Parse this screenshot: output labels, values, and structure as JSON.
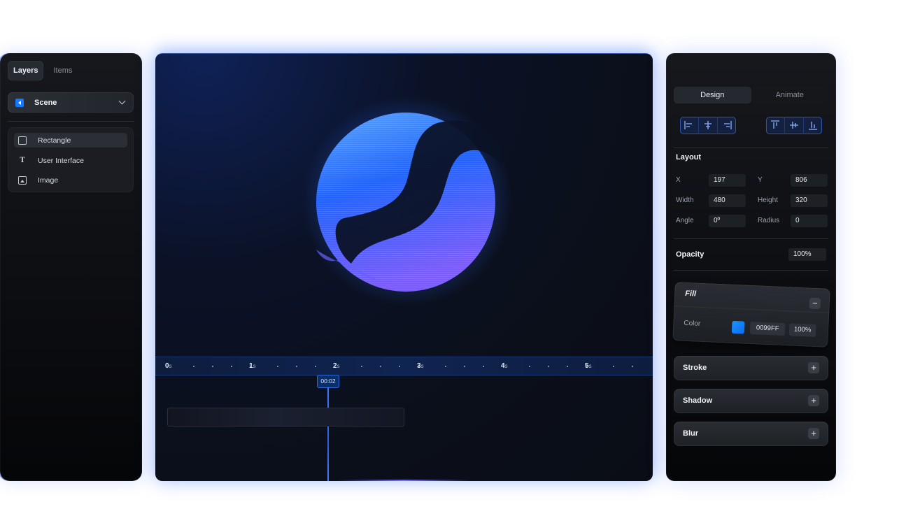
{
  "left_panel": {
    "tabs": [
      {
        "label": "Layers",
        "active": true
      },
      {
        "label": "Items",
        "active": false
      }
    ],
    "scene_select": {
      "label": "Scene",
      "icon": "play-left-icon"
    },
    "layers": [
      {
        "label": "Rectangle",
        "icon": "rectangle-icon",
        "selected": true
      },
      {
        "label": "User Interface",
        "icon": "text-icon",
        "selected": false
      },
      {
        "label": "Image",
        "icon": "image-icon",
        "selected": false
      }
    ]
  },
  "canvas": {
    "art": "blue-gradient-sphere",
    "timeline": {
      "ticks": [
        {
          "num": "0",
          "unit": "s"
        },
        {
          "num": "1",
          "unit": "s"
        },
        {
          "num": "2",
          "unit": "s"
        },
        {
          "num": "3",
          "unit": "s"
        },
        {
          "num": "4",
          "unit": "s"
        },
        {
          "num": "5",
          "unit": "s"
        }
      ],
      "playhead": "00:02"
    }
  },
  "right_panel": {
    "tabs": [
      {
        "label": "Design",
        "active": true
      },
      {
        "label": "Animate",
        "active": false
      }
    ],
    "align_horizontal": [
      "align-left-icon",
      "align-center-h-icon",
      "align-right-icon"
    ],
    "align_vertical": [
      "align-top-icon",
      "align-center-v-icon",
      "align-bottom-icon"
    ],
    "layout": {
      "title": "Layout",
      "x_label": "X",
      "x_value": "197",
      "y_label": "Y",
      "y_value": "806",
      "width_label": "Width",
      "width_value": "480",
      "height_label": "Height",
      "height_value": "320",
      "angle_label": "Angle",
      "angle_value": "0º",
      "radius_label": "Radius",
      "radius_value": "0"
    },
    "opacity": {
      "label": "Opacity",
      "value": "100%"
    },
    "fill": {
      "title": "Fill",
      "color_label": "Color",
      "hex": "0099FF",
      "swatch_color": "#1E90FF",
      "opacity": "100%",
      "action": "−"
    },
    "stroke": {
      "title": "Stroke",
      "action": "+"
    },
    "shadow": {
      "title": "Shadow",
      "action": "+"
    },
    "blur": {
      "title": "Blur",
      "action": "+"
    }
  },
  "colors": {
    "accent": "#1477FF",
    "timeline_bg": "#0F2450",
    "panel_bg": "#0C0D11"
  }
}
